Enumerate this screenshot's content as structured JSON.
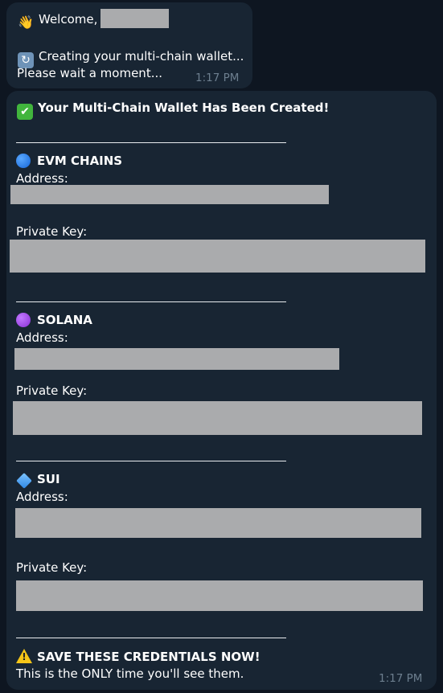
{
  "message1": {
    "greeting": "Welcome,",
    "status_line1": "Creating your multi-chain wallet...",
    "status_line2": "Please wait a moment...",
    "time": "1:17 PM"
  },
  "message2": {
    "title": "Your Multi-Chain Wallet Has Been Created!",
    "sections": [
      {
        "name": "EVM CHAINS",
        "icon": "blue-circle-icon",
        "address_label": "Address:",
        "private_key_label": "Private Key:"
      },
      {
        "name": "SOLANA",
        "icon": "purple-circle-icon",
        "address_label": "Address:",
        "private_key_label": "Private Key:"
      },
      {
        "name": "SUI",
        "icon": "blue-diamond-icon",
        "address_label": "Address:",
        "private_key_label": "Private Key:"
      }
    ],
    "warning_title": "SAVE THESE CREDENTIALS NOW!",
    "warning_text": "This is the ONLY time you'll see them.",
    "time": "1:17 PM"
  },
  "icons": {
    "wave": "waving-hand-icon",
    "spinner": "refresh-icon",
    "check": "check-mark-icon",
    "warning": "warning-icon"
  },
  "colors": {
    "background": "#0e1621",
    "bubble": "#182533",
    "redaction": "#aaabad",
    "timestamp": "#6d7f8f"
  }
}
